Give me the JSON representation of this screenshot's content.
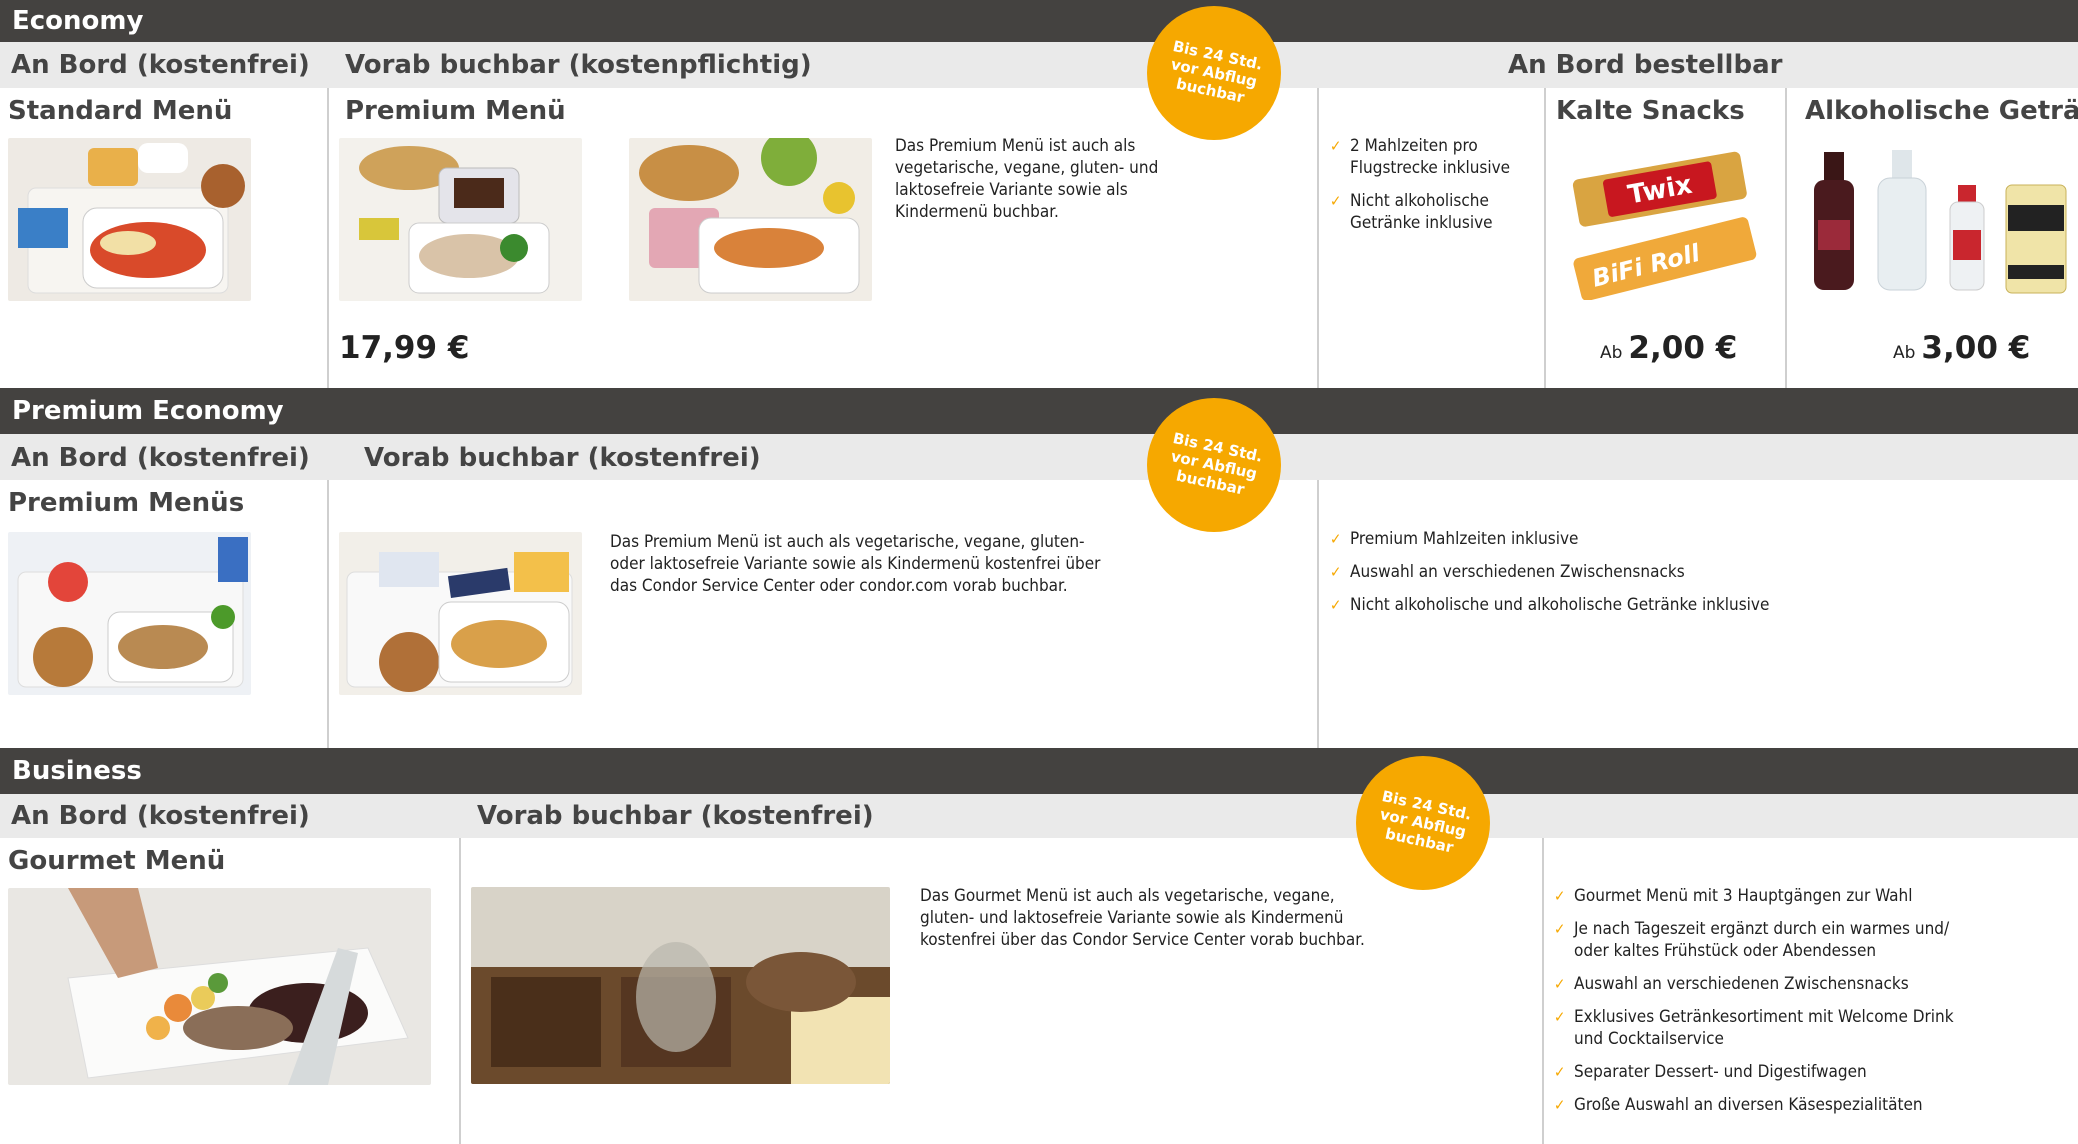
{
  "economy": {
    "band": "Economy",
    "sub_onboard": "An Bord (kostenfrei)",
    "sub_prebook": "Vorab buchbar (kostenpflichtig)",
    "sub_orderable": "An Bord bestellbar",
    "badge": "Bis 24 Std. vor Abflug buchbar",
    "standard_title": "Standard Menü",
    "premium_title": "Premium Menü",
    "premium_desc": "Das Premium Menü ist auch als vegetarische, vegane, gluten- und laktosefreie Variante sowie als Kindermenü buchbar.",
    "premium_price": "17,99 €",
    "checks": [
      "2 Mahlzeiten pro Flugstrecke inklusive",
      "Nicht alkoholische Getränke inklusive"
    ],
    "snacks_title": "Kalte Snacks",
    "snacks_price_prefix": "Ab",
    "snacks_price": "2,00 €",
    "drinks_title": "Alkoholische Getränke",
    "drinks_price_prefix": "Ab",
    "drinks_price": "3,00 €",
    "twix_label": "Twix",
    "bifi_label": "BiFi Roll"
  },
  "premium_economy": {
    "band": "Premium Economy",
    "sub_onboard": "An Bord (kostenfrei)",
    "sub_prebook": "Vorab buchbar (kostenfrei)",
    "badge": "Bis 24 Std. vor Abflug buchbar",
    "menus_title": "Premium Menüs",
    "desc": "Das Premium Menü ist auch als vegetarische, vegane, gluten- oder laktosefreie Variante sowie als Kindermenü kostenfrei über das Condor Service Center oder condor.com vorab buchbar.",
    "checks": [
      "Premium Mahlzeiten inklusive",
      "Auswahl an verschiedenen Zwischensnacks",
      "Nicht alkoholische und alkoholische Getränke inklusive"
    ]
  },
  "business": {
    "band": "Business",
    "sub_onboard": "An Bord (kostenfrei)",
    "sub_prebook": "Vorab buchbar (kostenfrei)",
    "badge": "Bis 24 Std. vor Abflug buchbar",
    "gourmet_title": "Gourmet Menü",
    "desc": "Das Gourmet Menü ist auch als vegetarische, vegane, gluten- und laktosefreie Variante sowie als Kindermenü kostenfrei über das Condor Service Center vorab buchbar.",
    "checks": [
      "Gourmet Menü mit 3 Hauptgängen zur Wahl",
      "Je nach Tageszeit ergänzt durch ein warmes und/ oder kaltes Frühstück oder Abendessen",
      "Auswahl an verschiedenen Zwischensnacks",
      "Exklusives Getränkesortiment mit Welcome Drink und Cocktailservice",
      "Separater Dessert- und Digestifwagen",
      "Große Auswahl an diversen Käsespezialitäten"
    ]
  },
  "colors": {
    "band": "#444240",
    "sub": "#eaeaea",
    "accent": "#f6a800"
  }
}
